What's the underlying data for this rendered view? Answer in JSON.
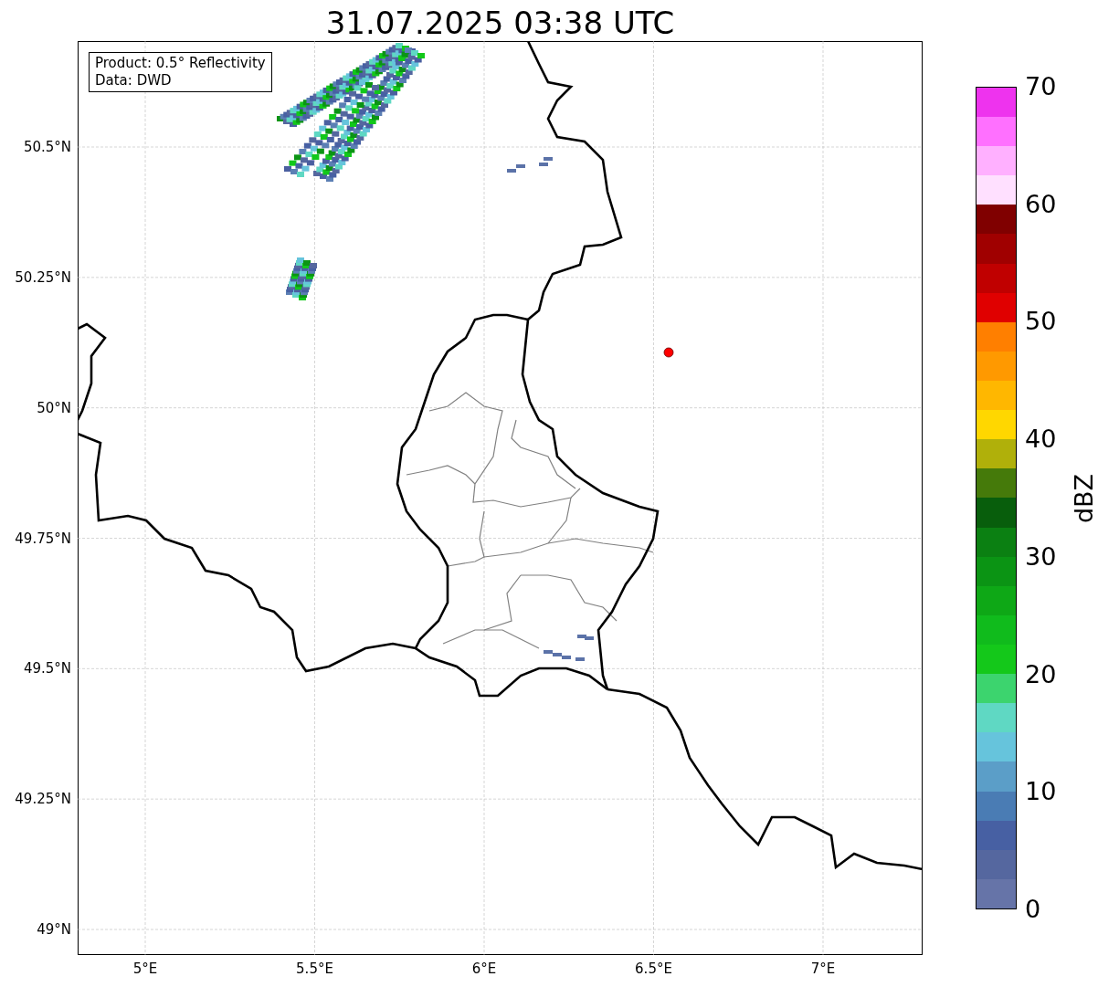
{
  "title": "31.07.2025 03:38 UTC",
  "info_box": {
    "lines": [
      "Product: 0.5° Reflectivity",
      "Data: DWD"
    ]
  },
  "map": {
    "lat_ticks": [
      "50.5°N",
      "50.25°N",
      "50°N",
      "49.75°N",
      "49.5°N",
      "49.25°N",
      "49°N"
    ],
    "lon_ticks": [
      "5°E",
      "5.5°E",
      "6°E",
      "6.5°E",
      "7°E"
    ]
  },
  "colorbar": {
    "label": "dBZ",
    "ticks": [
      "70",
      "60",
      "50",
      "40",
      "30",
      "20",
      "10",
      "0"
    ],
    "segments": [
      {
        "color": "#6674a8"
      },
      {
        "color": "#55679f"
      },
      {
        "color": "#4760a3"
      },
      {
        "color": "#4a7cb4"
      },
      {
        "color": "#5b9ec8"
      },
      {
        "color": "#66c4dc"
      },
      {
        "color": "#5fd8c3"
      },
      {
        "color": "#3cd46e"
      },
      {
        "color": "#14c81a"
      },
      {
        "color": "#10bb1c"
      },
      {
        "color": "#0ea816"
      },
      {
        "color": "#0b9414"
      },
      {
        "color": "#0b8012"
      },
      {
        "color": "#085e0c"
      },
      {
        "color": "#457a0a"
      },
      {
        "color": "#b0b00a"
      },
      {
        "color": "#ffd700"
      },
      {
        "color": "#ffb700"
      },
      {
        "color": "#ff9900"
      },
      {
        "color": "#ff7f00"
      },
      {
        "color": "#e00000"
      },
      {
        "color": "#c00000"
      },
      {
        "color": "#a00000"
      },
      {
        "color": "#800000"
      },
      {
        "color": "#ffe0ff"
      },
      {
        "color": "#ffb0ff"
      },
      {
        "color": "#ff70ff"
      },
      {
        "color": "#ee33ee"
      }
    ]
  }
}
